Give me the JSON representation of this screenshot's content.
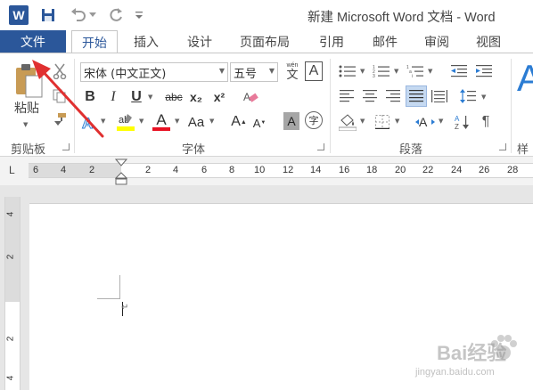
{
  "app": {
    "title": "新建 Microsoft Word 文档 - Word",
    "logo_letter": "W"
  },
  "tabs": {
    "file": "文件",
    "items": [
      "开始",
      "插入",
      "设计",
      "页面布局",
      "引用",
      "邮件",
      "审阅",
      "视图"
    ],
    "active_index": 0
  },
  "ribbon": {
    "clipboard": {
      "group_label": "剪贴板",
      "paste_label": "粘贴"
    },
    "font": {
      "group_label": "字体",
      "font_name": "宋体 (中文正文)",
      "font_size": "五号",
      "wen_label": "wén",
      "wen_char": "文",
      "char_border": "A",
      "bold": "B",
      "italic": "I",
      "underline": "U",
      "strike": "abc",
      "subscript": "x₂",
      "superscript": "x²",
      "font_color": "A",
      "case": "Aa",
      "grow": "A",
      "shrink": "A",
      "shade": "A",
      "enclose": "字"
    },
    "paragraph": {
      "group_label": "段落"
    },
    "styles": {
      "group_label": "样式"
    }
  },
  "ruler": {
    "tab_selector": "L",
    "left_numbers": [
      "6",
      "4",
      "2"
    ],
    "right_numbers": [
      "2",
      "4",
      "6",
      "8",
      "10",
      "12",
      "14",
      "16",
      "18",
      "20",
      "22",
      "24",
      "26",
      "28"
    ],
    "vertical_numbers": [
      "4",
      "2",
      "2",
      "4"
    ]
  },
  "watermark": {
    "text": "Bai经验",
    "url": "jingyan.baidu.com"
  },
  "colors": {
    "word_blue": "#2b579a",
    "annotation_red": "#e03030",
    "highlight_yellow": "#ffff00",
    "font_color_red": "#e81123"
  }
}
